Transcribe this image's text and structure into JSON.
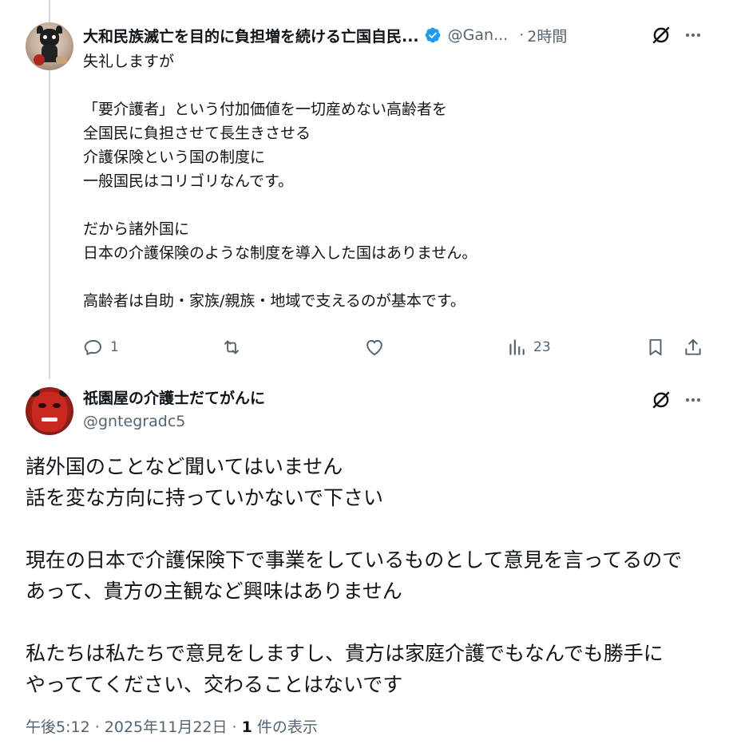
{
  "tweet1": {
    "display_name": "大和民族滅亡を目的に負担増を続ける亡国自民...",
    "handle": "@Gan...",
    "time": "2時間",
    "lines": [
      "失礼しますが",
      "",
      "「要介護者」という付加価値を一切産めない高齢者を",
      "全国民に負担させて長生きさせる",
      "介護保険という国の制度に",
      "一般国民はコリゴリなんです。",
      "",
      "だから諸外国に",
      "日本の介護保険のような制度を導入した国はありません。",
      "",
      "高齢者は自助・家族/親族・地域で支えるのが基本です。"
    ],
    "reply_count": "1",
    "view_count": "23",
    "verified_color": "#1d9bf0"
  },
  "tweet2": {
    "display_name": "祇園屋の介護士だてがんに",
    "handle": "@gntegradc5",
    "lines": [
      "諸外国のことなど聞いてはいません",
      "話を変な方向に持っていかないで下さい",
      "",
      "現在の日本で介護保険下で事業をしているものとして意見を言ってるので",
      "あって、貴方の主観など興味はありません",
      "",
      "私たちは私たちで意見をしますし、貴方は家庭介護でもなんでも勝手に",
      "やっててください、交わることはないです"
    ],
    "timestamp": "午後5:12 · 2025年11月22日 · ",
    "views_number": "1",
    "views_suffix": " 件の表示"
  },
  "icons": {
    "reply": "reply-icon",
    "retweet": "retweet-icon",
    "like": "like-icon",
    "views": "views-icon",
    "bookmark": "bookmark-icon",
    "share": "share-icon",
    "grok": "grok-icon",
    "more": "more-icon"
  },
  "colors": {
    "text": "#0f1419",
    "muted": "#536471",
    "thread_line": "#cfd9de"
  }
}
